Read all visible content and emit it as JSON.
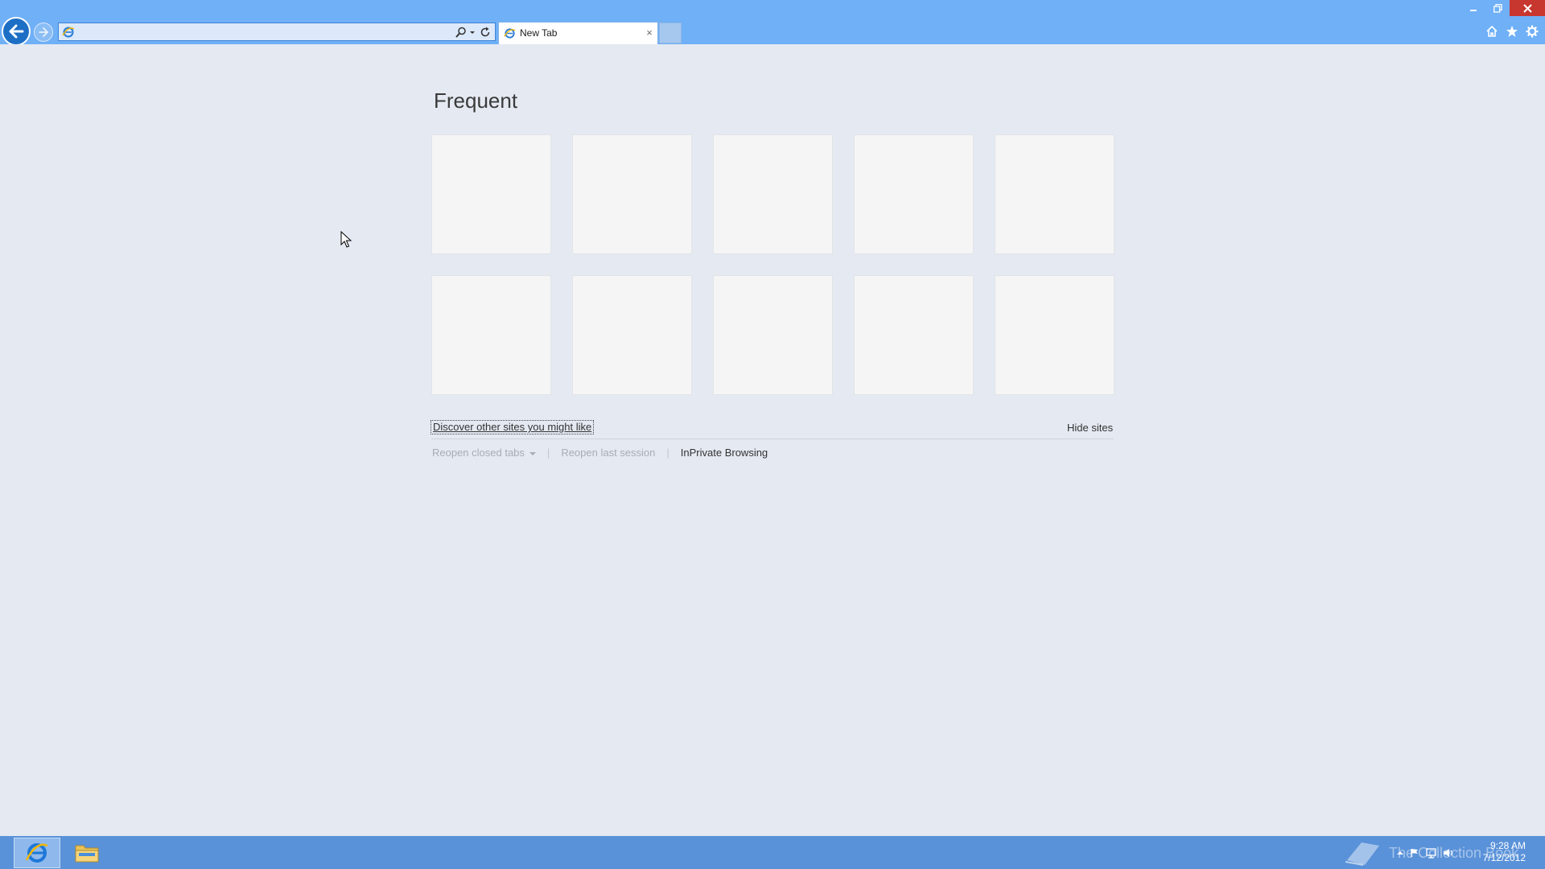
{
  "window": {
    "controls": {
      "minimize_icon": "minimize-icon",
      "restore_icon": "restore-icon",
      "close_icon": "close-icon"
    },
    "colors": {
      "chrome": "#6fb0f7",
      "close": "#c7372f",
      "taskbar": "#5a92d9",
      "page": "#e4e9f2"
    }
  },
  "navigation": {
    "back_icon": "back-arrow-icon",
    "forward_icon": "forward-arrow-icon"
  },
  "address_bar": {
    "value": "",
    "site_icon": "ie-page-icon",
    "search_icon": "search-icon",
    "dropdown_icon": "chevron-down-icon",
    "refresh_icon": "refresh-icon"
  },
  "tabs": [
    {
      "label": "New Tab",
      "icon": "ie-page-icon",
      "close_label": "×"
    }
  ],
  "toolbar": {
    "home_icon": "home-icon",
    "favorites_icon": "star-icon",
    "tools_icon": "gear-icon"
  },
  "new_tab_page": {
    "heading": "Frequent",
    "tiles": [
      {
        "name": "tile-1"
      },
      {
        "name": "tile-2"
      },
      {
        "name": "tile-3"
      },
      {
        "name": "tile-4"
      },
      {
        "name": "tile-5"
      },
      {
        "name": "tile-6"
      },
      {
        "name": "tile-7"
      },
      {
        "name": "tile-8"
      },
      {
        "name": "tile-9"
      },
      {
        "name": "tile-10"
      }
    ],
    "discover_link": "Discover other sites you might like",
    "hide_sites": "Hide sites",
    "reopen_closed_tabs": "Reopen closed tabs",
    "separator": "|",
    "reopen_last_session": "Reopen last session",
    "inprivate": "InPrivate Browsing"
  },
  "taskbar": {
    "apps": [
      {
        "name": "Internet Explorer",
        "icon": "ie-icon",
        "active": true
      },
      {
        "name": "File Explorer",
        "icon": "folder-icon",
        "active": false
      }
    ],
    "watermark": "The Collection Book",
    "clock_time": "9:28 AM",
    "clock_date": "7/12/2012"
  }
}
